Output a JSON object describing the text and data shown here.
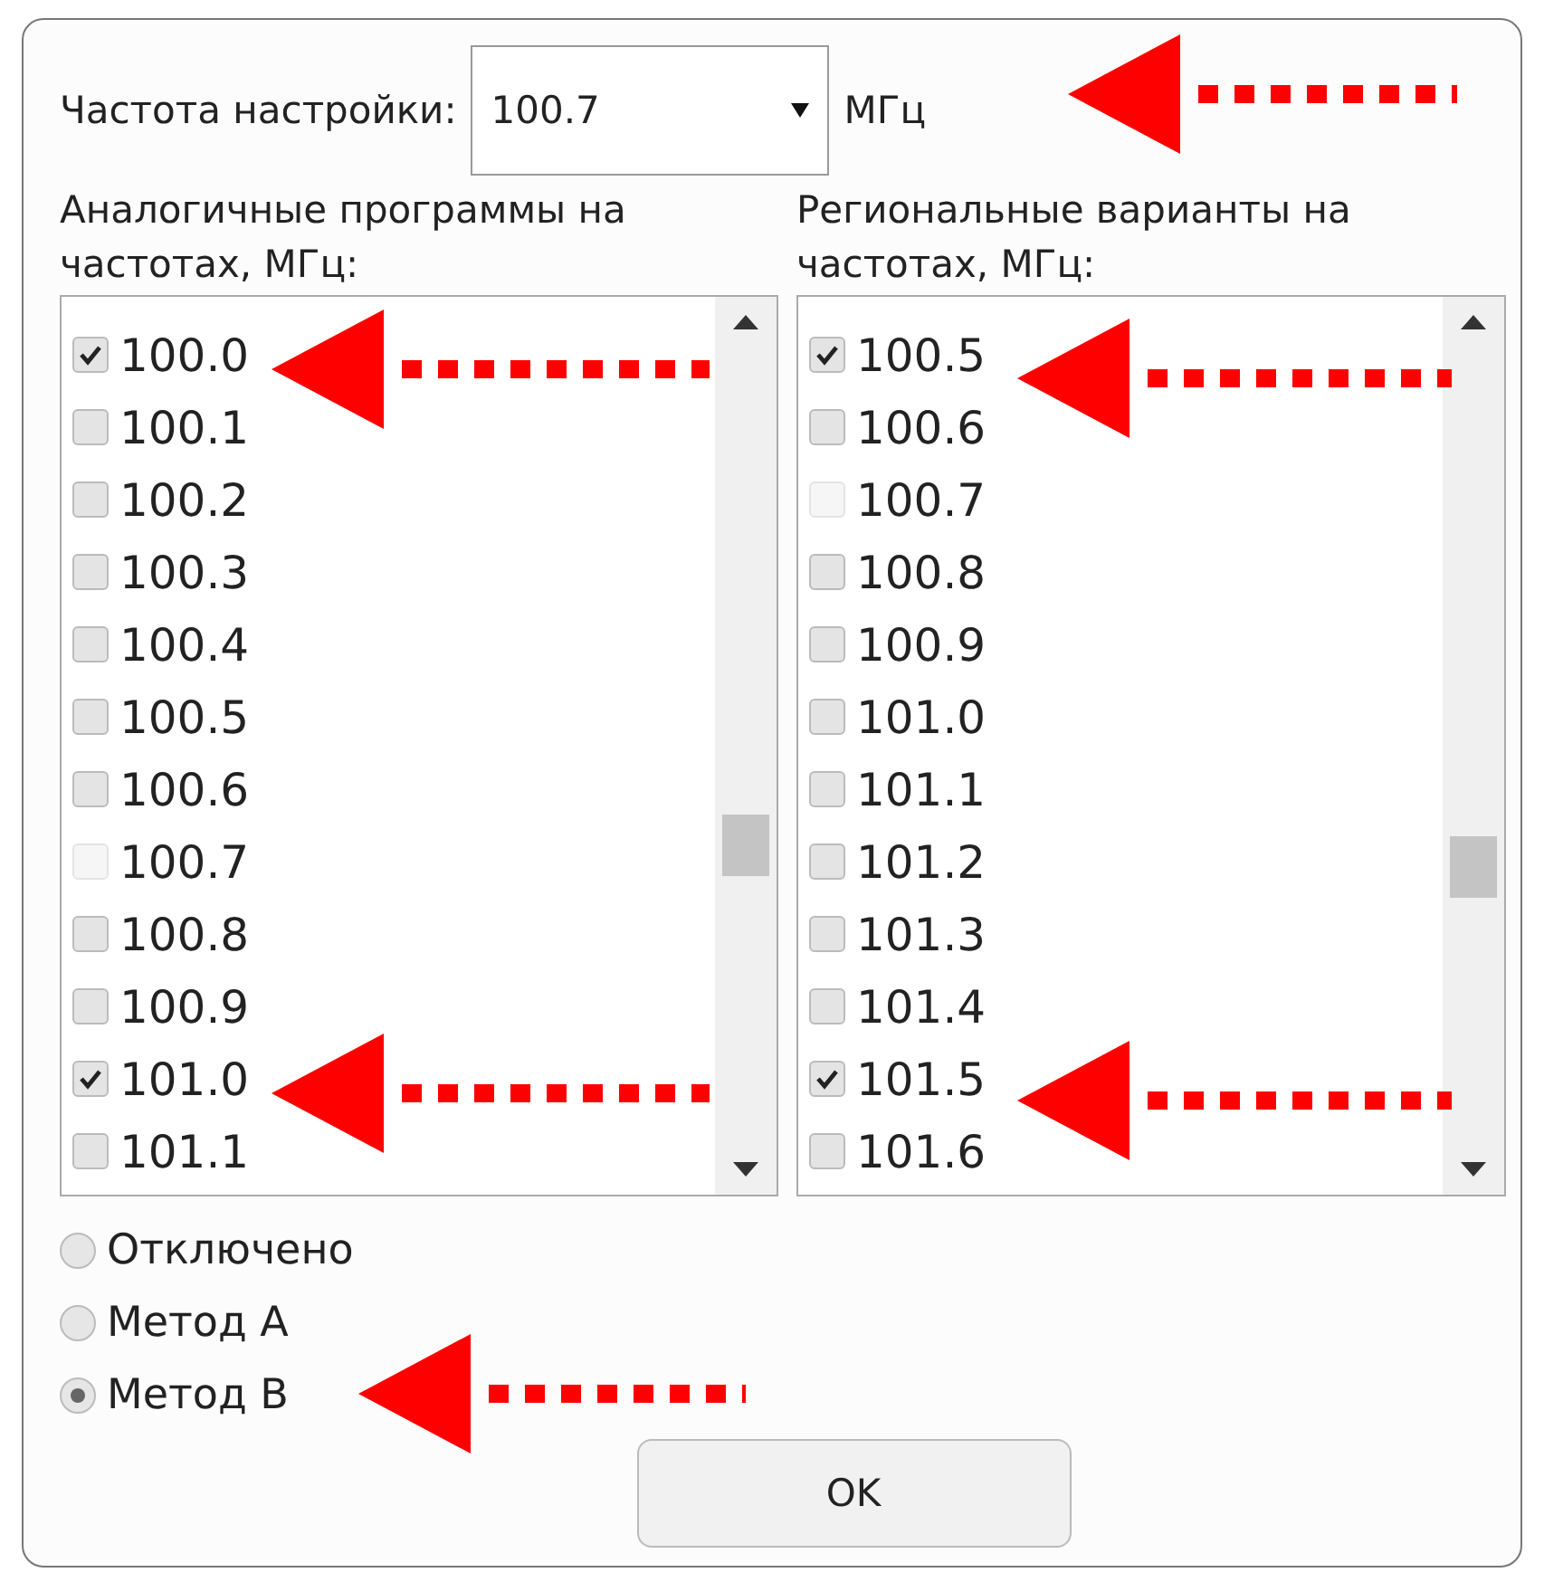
{
  "tuning": {
    "label": "Частота настройки:",
    "value": "100.7",
    "unit": "МГц"
  },
  "analog": {
    "title": "Аналогичные программы на частотах, МГц:",
    "items": [
      {
        "label": "100.0",
        "checked": true,
        "disabled": false
      },
      {
        "label": "100.1",
        "checked": false,
        "disabled": false
      },
      {
        "label": "100.2",
        "checked": false,
        "disabled": false
      },
      {
        "label": "100.3",
        "checked": false,
        "disabled": false
      },
      {
        "label": "100.4",
        "checked": false,
        "disabled": false
      },
      {
        "label": "100.5",
        "checked": false,
        "disabled": false
      },
      {
        "label": "100.6",
        "checked": false,
        "disabled": false
      },
      {
        "label": "100.7",
        "checked": false,
        "disabled": true
      },
      {
        "label": "100.8",
        "checked": false,
        "disabled": false
      },
      {
        "label": "100.9",
        "checked": false,
        "disabled": false
      },
      {
        "label": "101.0",
        "checked": true,
        "disabled": false
      },
      {
        "label": "101.1",
        "checked": false,
        "disabled": false
      }
    ]
  },
  "regional": {
    "title": "Региональные варианты на частотах, МГц:",
    "items": [
      {
        "label": "100.5",
        "checked": true,
        "disabled": false
      },
      {
        "label": "100.6",
        "checked": false,
        "disabled": false
      },
      {
        "label": "100.7",
        "checked": false,
        "disabled": true
      },
      {
        "label": "100.8",
        "checked": false,
        "disabled": false
      },
      {
        "label": "100.9",
        "checked": false,
        "disabled": false
      },
      {
        "label": "101.0",
        "checked": false,
        "disabled": false
      },
      {
        "label": "101.1",
        "checked": false,
        "disabled": false
      },
      {
        "label": "101.2",
        "checked": false,
        "disabled": false
      },
      {
        "label": "101.3",
        "checked": false,
        "disabled": false
      },
      {
        "label": "101.4",
        "checked": false,
        "disabled": false
      },
      {
        "label": "101.5",
        "checked": true,
        "disabled": false
      },
      {
        "label": "101.6",
        "checked": false,
        "disabled": false
      }
    ]
  },
  "methods": [
    {
      "label": "Отключено",
      "selected": false
    },
    {
      "label": "Метод A",
      "selected": false
    },
    {
      "label": "Метод B",
      "selected": true
    }
  ],
  "ok_button": "OK"
}
